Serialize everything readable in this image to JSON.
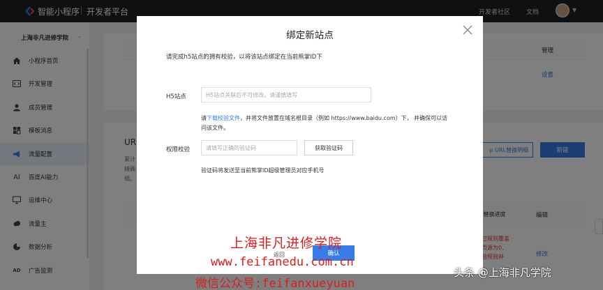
{
  "topbar": {
    "brand": "智能小程序",
    "platform": "开发者平台",
    "link_community": "开发者社区",
    "link_docs": "文档"
  },
  "sidebar": {
    "org_name": "上海非凡进修学院",
    "items": [
      {
        "label": "小程序首页",
        "icon": "home-icon"
      },
      {
        "label": "开发管理",
        "icon": "code-icon"
      },
      {
        "label": "成员管理",
        "icon": "user-icon"
      },
      {
        "label": "模板消息",
        "icon": "template-icon"
      },
      {
        "label": "流量配置",
        "icon": "megaphone-icon",
        "active": true
      },
      {
        "label": "百度AI能力",
        "icon": "ai-icon"
      },
      {
        "label": "运维中心",
        "icon": "monitor-icon"
      },
      {
        "label": "流量主",
        "icon": "cloud-icon"
      },
      {
        "label": "数据分析",
        "icon": "chart-icon"
      },
      {
        "label": "广告监测",
        "icon": "ad-icon"
      }
    ]
  },
  "background": {
    "table1_header_manage": "管理",
    "table1_action_set": "设置",
    "section_title": "UR",
    "desc_line1": "累计",
    "desc_line2": "精确",
    "desc_line3": "细。",
    "btn_replace": "p URL替换明细",
    "btn_new": "新建",
    "table2_header_progress": "L替换进度",
    "table2_header_edit": "编辑",
    "red_line1": "过规则覆盖",
    "red_line2": "页源为0,",
    "red_line3": "验规则并",
    "table2_action_edit": "修改"
  },
  "modal": {
    "title": "绑定新站点",
    "intro": "请完成h5站点的拥有校验，以将该站点绑定在当前熊掌ID下",
    "h5_label": "H5站点",
    "h5_placeholder": "H5站点关联后不可修改，请谨慎填写",
    "tip_prefix": "请",
    "tip_link": "下载校验文件",
    "tip_suffix": "，并将文件放置在域名根目录（例如 https://www.baidu.com）下， 并确保可以访问该文件。",
    "verify_label": "权限校验",
    "code_placeholder": "请填写正确的验证码",
    "get_code_button": "获取验证码",
    "code_tip": "验证码将发送至当前熊掌ID超级管理员对应手机号",
    "back_button": "返回",
    "confirm_button": "确认"
  },
  "watermark": {
    "line1": "上海非凡进修学院",
    "line2": "www.feifanedu.com.cn",
    "line3": "微信公众号:feifanxueyuan",
    "corner": "头条 @上海非凡学院"
  },
  "colors": {
    "accent": "#3a7ce6",
    "topbar": "#1f2023",
    "watermark": "#d81e1e",
    "warning": "#e53935"
  }
}
